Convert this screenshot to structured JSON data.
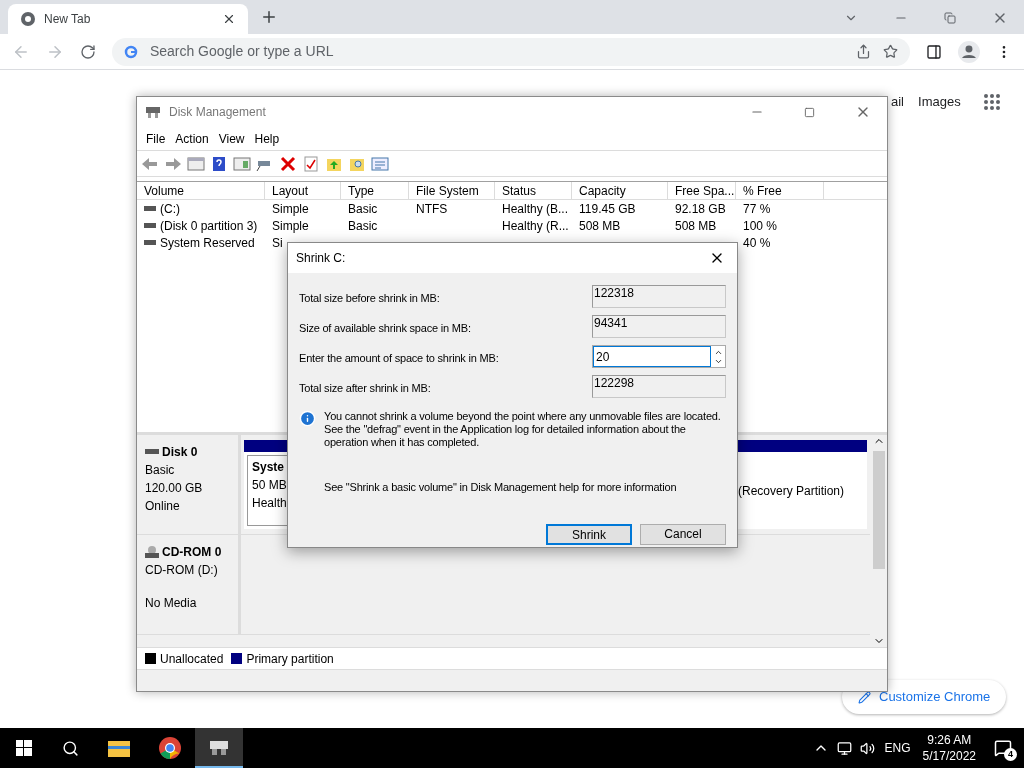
{
  "browser": {
    "tab": {
      "title": "New Tab",
      "selected": true
    },
    "address": {
      "placeholder": "Search Google or type a URL"
    },
    "links": [
      "ail",
      "Images"
    ],
    "customize": "Customize Chrome"
  },
  "window": {
    "title": "Disk Management",
    "menu": [
      "File",
      "Action",
      "View",
      "Help"
    ],
    "table": {
      "columns": [
        "Volume",
        "Layout",
        "Type",
        "File System",
        "Status",
        "Capacity",
        "Free Spa...",
        "% Free"
      ],
      "rows": [
        {
          "cells": [
            "(C:)",
            "Simple",
            "Basic",
            "NTFS",
            "Healthy (B...",
            "119.45 GB",
            "92.18 GB",
            "77 %"
          ]
        },
        {
          "cells": [
            "(Disk 0 partition 3)",
            "Simple",
            "Basic",
            null,
            "Healthy (R...",
            "508 MB",
            "508 MB",
            "100 %"
          ]
        },
        {
          "cells": [
            "System Reserved",
            "Si",
            null,
            null,
            null,
            null,
            null,
            "40 %"
          ]
        }
      ]
    },
    "disks": [
      {
        "kind": "disk",
        "name": "Disk 0",
        "type": "Basic",
        "size": "120.00 GB",
        "status": "Online",
        "partitions": [
          {
            "lines": [
              "Syste",
              "50 MB",
              "Health"
            ]
          }
        ],
        "tail": "(Recovery Partition)"
      },
      {
        "kind": "cdrom",
        "name": "CD-ROM 0",
        "type": "CD-ROM (D:)",
        "status": "No Media"
      }
    ],
    "legend": [
      {
        "label": "Unallocated",
        "color": "#000000"
      },
      {
        "label": "Primary partition",
        "color": "#000080"
      }
    ]
  },
  "dialog": {
    "title": "Shrink C:",
    "fields": [
      {
        "kind": "readonly",
        "label": "Total size before shrink in MB:",
        "value": "122318"
      },
      {
        "kind": "readonly",
        "label": "Size of available shrink space in MB:",
        "value": "94341"
      },
      {
        "kind": "spin",
        "label": "Enter the amount of space to shrink in MB:",
        "value": "20"
      },
      {
        "kind": "readonly",
        "label": "Total size after shrink in MB:",
        "value": "122298"
      }
    ],
    "info": "You cannot shrink a volume beyond the point where any unmovable files are located. See the \"defrag\" event in the Application log for detailed information about the operation when it has completed.",
    "help": "See \"Shrink a basic volume\" in Disk Management help for more information",
    "buttons": [
      {
        "label": "Shrink",
        "default": true
      },
      {
        "label": "Cancel",
        "default": false
      }
    ]
  },
  "taskbar": {
    "language": "ENG",
    "time": "9:26 AM",
    "date": "5/17/2022",
    "notifications": "4"
  }
}
